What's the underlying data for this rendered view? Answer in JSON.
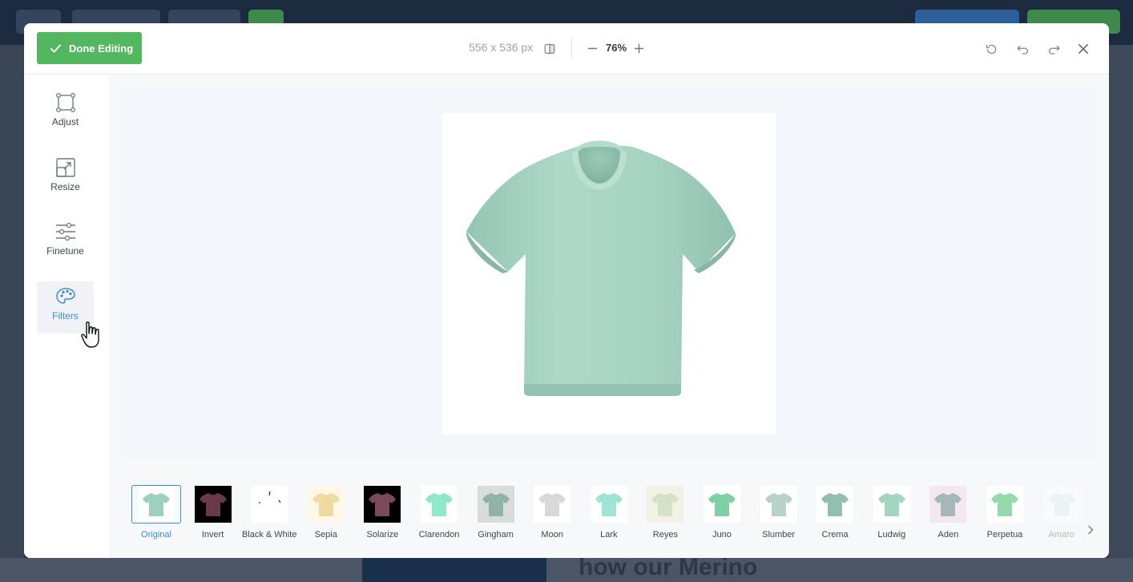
{
  "header": {
    "done_label": "Done Editing",
    "dimensions": "556 x 536 px",
    "zoom": "76%"
  },
  "tools": [
    {
      "label": "Adjust",
      "icon": "crop-icon"
    },
    {
      "label": "Resize",
      "icon": "resize-icon"
    },
    {
      "label": "Finetune",
      "icon": "sliders-icon"
    },
    {
      "label": "Filters",
      "icon": "palette-icon",
      "active": true
    }
  ],
  "filters": [
    {
      "label": "Original",
      "selected": true,
      "color": "#9dd1bd",
      "bg": "#ffffff"
    },
    {
      "label": "Invert",
      "color": "#6a3a4a",
      "bg": "#000000"
    },
    {
      "label": "Black & White",
      "color": "#ffffff",
      "bg": "#ffffff"
    },
    {
      "label": "Sepia",
      "color": "#f1d9a3",
      "bg": "#fff8e6"
    },
    {
      "label": "Solarize",
      "color": "#7a4a58",
      "bg": "#000000"
    },
    {
      "label": "Clarendon",
      "color": "#8fe8c9",
      "bg": "#ffffff"
    },
    {
      "label": "Gingham",
      "color": "#8fb3a4",
      "bg": "#d9ddda"
    },
    {
      "label": "Moon",
      "color": "#d9d9d9",
      "bg": "#ffffff"
    },
    {
      "label": "Lark",
      "color": "#9ee3d4",
      "bg": "#ffffff"
    },
    {
      "label": "Reyes",
      "color": "#d6e2c8",
      "bg": "#f1f1e6"
    },
    {
      "label": "Juno",
      "color": "#7fd0a3",
      "bg": "#ffffff"
    },
    {
      "label": "Slumber",
      "color": "#b8d2c7",
      "bg": "#ffffff"
    },
    {
      "label": "Crema",
      "color": "#93bfae",
      "bg": "#ffffff"
    },
    {
      "label": "Ludwig",
      "color": "#a2d6bf",
      "bg": "#ffffff"
    },
    {
      "label": "Aden",
      "color": "#a4b8b6",
      "bg": "#f4e8f0"
    },
    {
      "label": "Perpetua",
      "color": "#93d9a9",
      "bg": "#ffffff"
    },
    {
      "label": "Amaro",
      "color": "#d6efe7",
      "bg": "#ffffff"
    }
  ],
  "colors": {
    "accent": "#3a8ad6",
    "done_green": "#52b75f",
    "shirt": "#a3d3c0"
  },
  "background_text": "how our Merino"
}
